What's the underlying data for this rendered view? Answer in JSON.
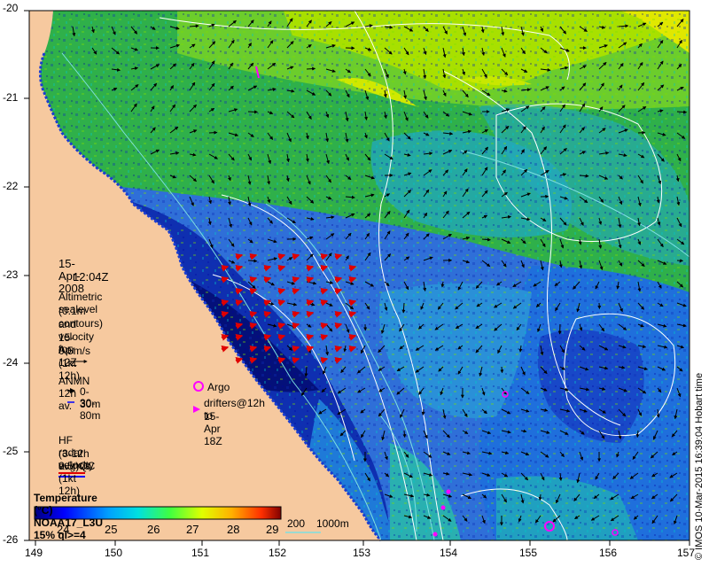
{
  "map": {
    "lon_ticks": [
      "149",
      "150",
      "151",
      "152",
      "153",
      "154",
      "155",
      "156",
      "157"
    ],
    "lat_ticks": [
      "-20",
      "-21",
      "-22",
      "-23",
      "-24",
      "-25",
      "-26"
    ],
    "colors": {
      "land": "#f6c99f",
      "contour": "#ffffff",
      "contour_shallow": "#7fe0e0",
      "velocity_arrow": "#000000",
      "radar_arrow": "#e00000",
      "argo": "#ff00ff"
    }
  },
  "annotations": {
    "date": "15-Apr-2008",
    "time": "12:04Z",
    "altimetry_text": [
      "Altimetric sealevel",
      "(0.1m contours)",
      "and velocity for",
      "15-Apr 12Z",
      "0.5m/s (1kt 12h)"
    ],
    "anmn_title": "ANMN 12h av.",
    "anmn_items": [
      "0-30m",
      "30-80m"
    ],
    "argo": "Argo",
    "drifters_text": [
      "drifters@12h to",
      "15-Apr 18Z"
    ],
    "hf_radar_text": [
      "HF radar velocity",
      "(3-12h avg)QC",
      "0.5m/s (1kt 12h)"
    ],
    "colorbar_title": "Temperature (°C) NOAA17_L3U 15% ql>=4",
    "colorbar_ticks": [
      "24",
      "25",
      "26",
      "27",
      "28",
      "29"
    ],
    "depth_legend": [
      "200",
      "1000m"
    ],
    "credit": "© IMOS 10-Mar-2015 16:39:04 Hobart time"
  }
}
